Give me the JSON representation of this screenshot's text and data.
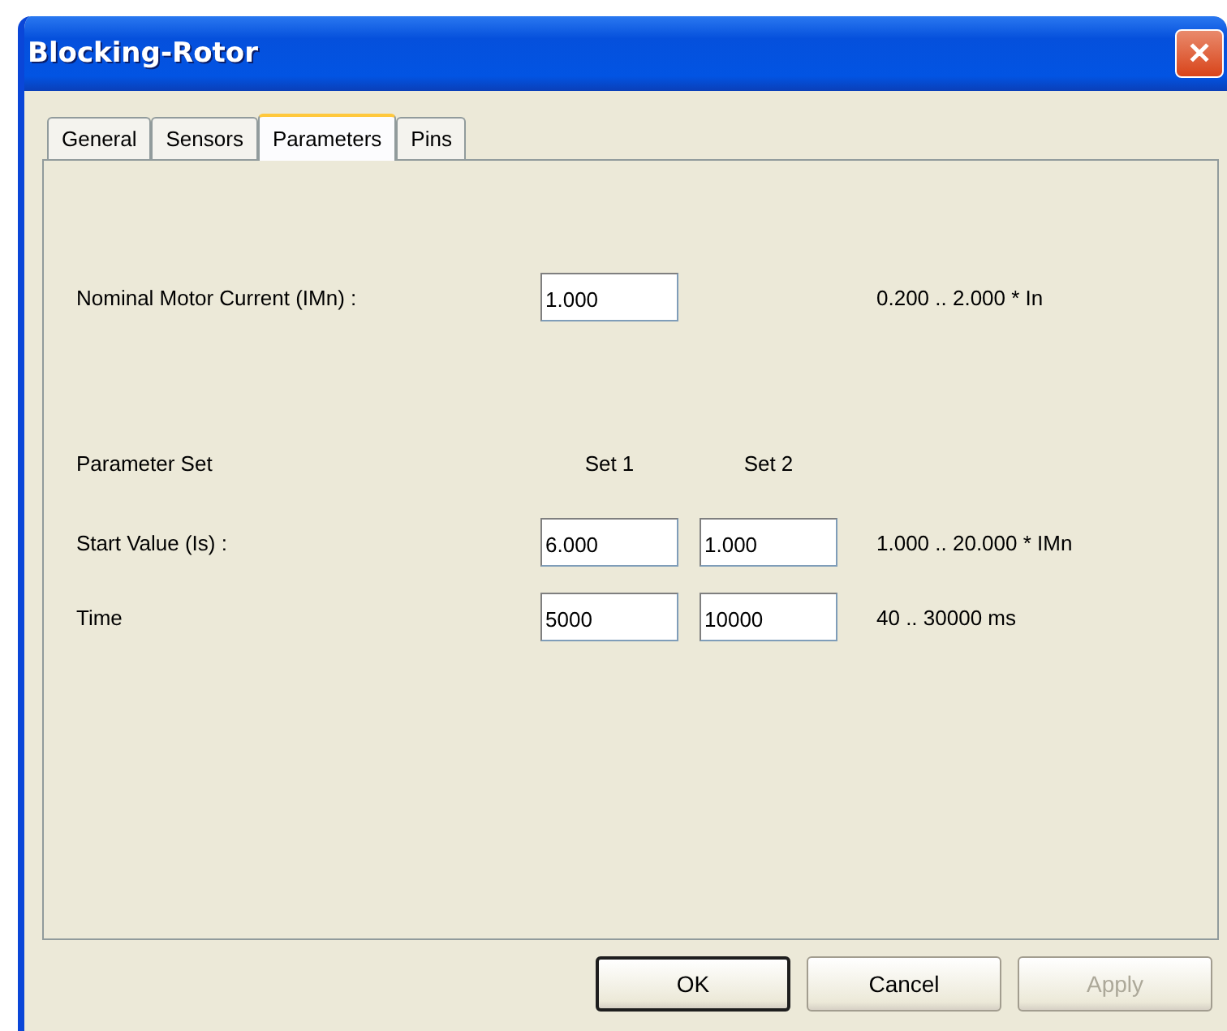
{
  "window": {
    "title": "Blocking-Rotor",
    "close_icon": "✕"
  },
  "tabs": [
    {
      "label": "General",
      "selected": false
    },
    {
      "label": "Sensors",
      "selected": false
    },
    {
      "label": "Parameters",
      "selected": true
    },
    {
      "label": "Pins",
      "selected": false
    }
  ],
  "nominal": {
    "label": "Nominal Motor Current (IMn) :",
    "value": "1.000",
    "range": "0.200 .. 2.000 * In"
  },
  "parameter_set": {
    "label": "Parameter Set",
    "columns": [
      "Set 1",
      "Set 2"
    ]
  },
  "rows": [
    {
      "label": "Start Value (Is) :",
      "values": [
        "6.000",
        "1.000"
      ],
      "range": "1.000 .. 20.000 * IMn"
    },
    {
      "label": "Time",
      "values": [
        "5000",
        "10000"
      ],
      "range": "40 .. 30000 ms"
    }
  ],
  "buttons": [
    {
      "label": "OK",
      "default": true,
      "disabled": false
    },
    {
      "label": "Cancel",
      "default": false,
      "disabled": false
    },
    {
      "label": "Apply",
      "default": false,
      "disabled": true
    }
  ]
}
